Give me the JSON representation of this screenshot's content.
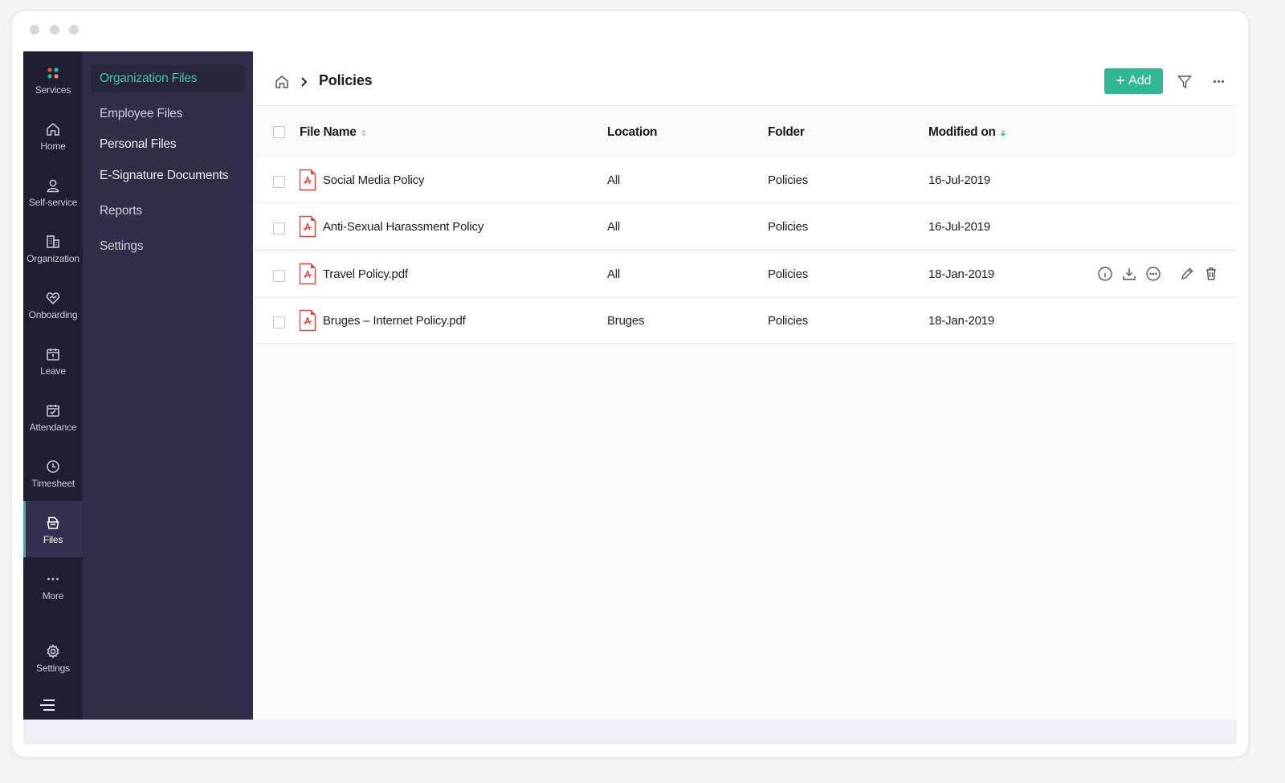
{
  "window": {
    "controls": [
      "close",
      "minimize",
      "maximize"
    ]
  },
  "rail": {
    "items": [
      {
        "key": "services",
        "label": "Services",
        "icon": "services-dots-icon"
      },
      {
        "key": "home",
        "label": "Home",
        "icon": "home-icon"
      },
      {
        "key": "self-service",
        "label": "Self-service",
        "icon": "user-icon"
      },
      {
        "key": "organization",
        "label": "Organization",
        "icon": "building-icon"
      },
      {
        "key": "onboarding",
        "label": "Onboarding",
        "icon": "handshake-icon"
      },
      {
        "key": "leave",
        "label": "Leave",
        "icon": "calendar-alert-icon"
      },
      {
        "key": "attendance",
        "label": "Attendance",
        "icon": "calendar-check-icon"
      },
      {
        "key": "timesheet",
        "label": "Timesheet",
        "icon": "clock-icon"
      },
      {
        "key": "files",
        "label": "Files",
        "icon": "files-icon",
        "active": true
      },
      {
        "key": "more",
        "label": "More",
        "icon": "more-dots-icon"
      },
      {
        "key": "settings",
        "label": "Settings",
        "icon": "gear-icon"
      }
    ],
    "menu_icon": "hamburger-icon"
  },
  "submenu": {
    "items": [
      {
        "label": "Organization Files",
        "active": true
      },
      {
        "label": "Employee Files"
      },
      {
        "label": "Personal Files"
      },
      {
        "label": "E-Signature Documents"
      },
      {
        "label": "Reports"
      },
      {
        "label": "Settings"
      }
    ]
  },
  "header": {
    "breadcrumb_home_icon": "home-icon",
    "breadcrumb_current": "Policies",
    "add_label": "Add",
    "add_color": "#31b794"
  },
  "table": {
    "columns": [
      {
        "label": "File Name",
        "sortable": true
      },
      {
        "label": "Location"
      },
      {
        "label": "Folder"
      },
      {
        "label": "Modified on",
        "sortable": true,
        "sort": "desc"
      }
    ],
    "rows": [
      {
        "name": "Social Media Policy",
        "location": "All",
        "folder": "Policies",
        "modified": "16-Jul-2019"
      },
      {
        "name": "Anti-Sexual Harassment Policy",
        "location": "All",
        "folder": "Policies",
        "modified": "16-Jul-2019"
      },
      {
        "name": "Travel Policy.pdf",
        "location": "All",
        "folder": "Policies",
        "modified": "18-Jan-2019",
        "hovered": true
      },
      {
        "name": "Bruges – Internet Policy.pdf",
        "location": "Bruges",
        "folder": "Policies",
        "modified": "18-Jan-2019"
      }
    ],
    "row_actions": [
      "info-icon",
      "download-icon",
      "more-options-icon",
      "edit-icon",
      "delete-icon"
    ]
  },
  "colors": {
    "accent": "#31b794",
    "rail_bg": "#1f1e33",
    "submenu_bg": "#302e4a",
    "pdf_red": "#e0473a"
  }
}
